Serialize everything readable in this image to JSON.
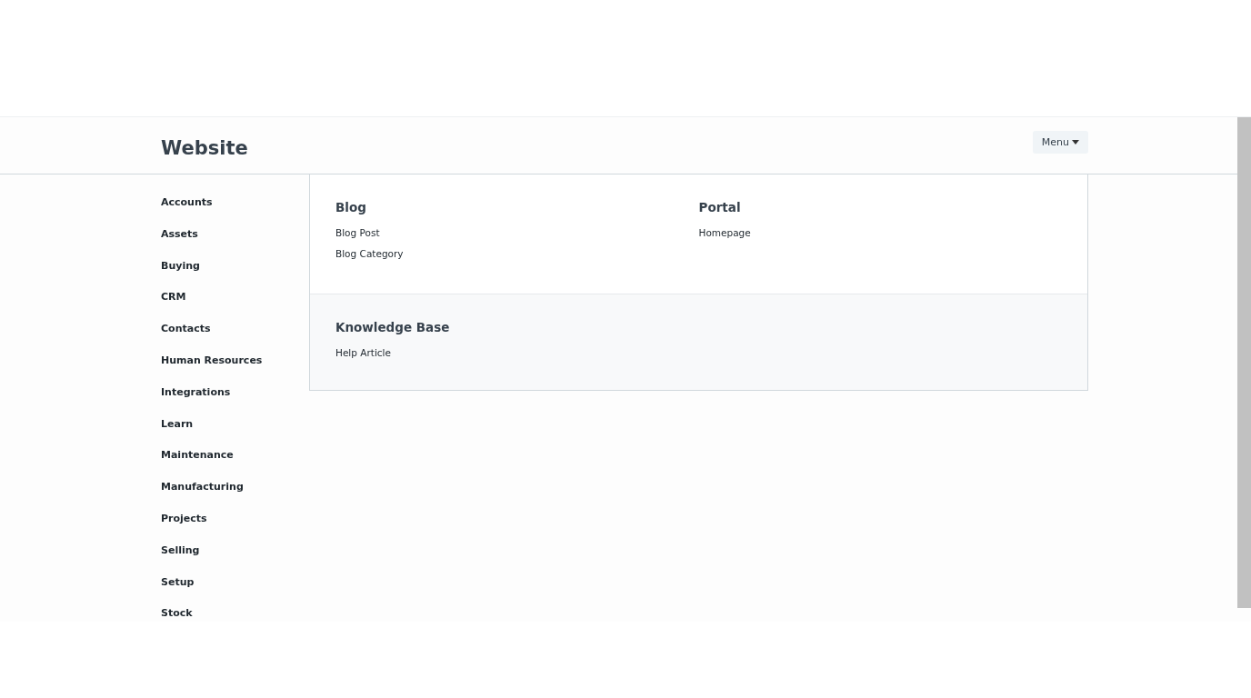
{
  "page_title": "Website",
  "menu_button": {
    "label": "Menu"
  },
  "sidebar": {
    "items": [
      {
        "label": "Accounts"
      },
      {
        "label": "Assets"
      },
      {
        "label": "Buying"
      },
      {
        "label": "CRM"
      },
      {
        "label": "Contacts"
      },
      {
        "label": "Human Resources"
      },
      {
        "label": "Integrations"
      },
      {
        "label": "Learn"
      },
      {
        "label": "Maintenance"
      },
      {
        "label": "Manufacturing"
      },
      {
        "label": "Projects"
      },
      {
        "label": "Selling"
      },
      {
        "label": "Setup"
      },
      {
        "label": "Stock"
      }
    ]
  },
  "sections": [
    {
      "cards": [
        {
          "title": "Blog",
          "links": [
            "Blog Post",
            "Blog Category"
          ]
        },
        {
          "title": "Portal",
          "links": [
            "Homepage"
          ]
        }
      ]
    },
    {
      "cards": [
        {
          "title": "Knowledge Base",
          "links": [
            "Help Article"
          ]
        }
      ]
    }
  ]
}
